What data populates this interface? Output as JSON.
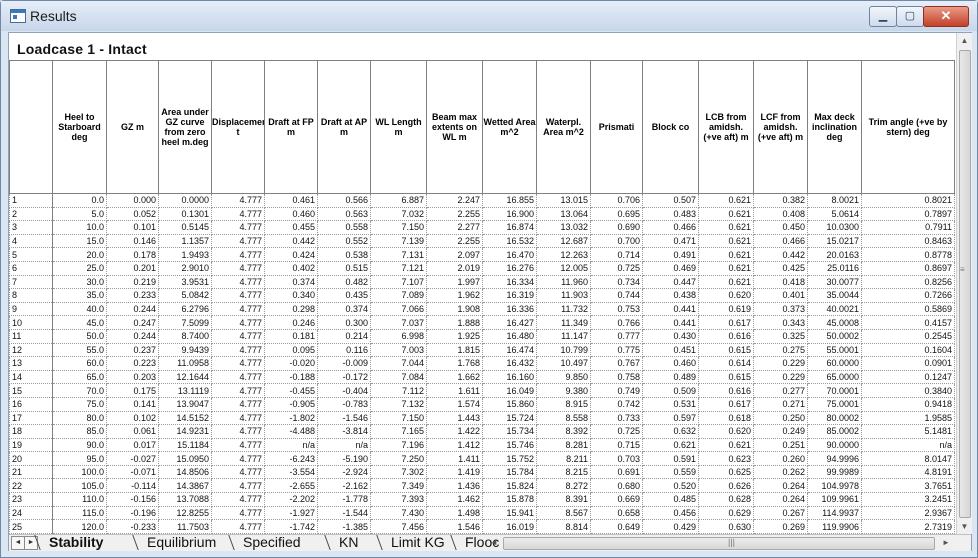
{
  "window": {
    "title": "Results",
    "minimize": "▁",
    "maximize": "▢",
    "close": "✕"
  },
  "loadcase_title": "Loadcase 1 - Intact",
  "columns": [
    "Heel to Starboard deg",
    "GZ m",
    "Area under GZ curve from zero heel m.deg",
    "Displacement t",
    "Draft at FP m",
    "Draft at AP m",
    "WL Length m",
    "Beam max extents on WL m",
    "Wetted Area m^2",
    "Waterpl. Area m^2",
    "Prismati",
    "Block co",
    "LCB from amidsh. (+ve aft) m",
    "LCF from amidsh. (+ve aft) m",
    "Max deck inclination deg",
    "Trim angle (+ve by stern) deg"
  ],
  "rows": [
    [
      "1",
      "0.0",
      "0.000",
      "0.0000",
      "4.777",
      "0.461",
      "0.566",
      "6.887",
      "2.247",
      "16.855",
      "13.015",
      "0.706",
      "0.507",
      "0.621",
      "0.382",
      "8.0021",
      "0.8021"
    ],
    [
      "2",
      "5.0",
      "0.052",
      "0.1301",
      "4.777",
      "0.460",
      "0.563",
      "7.032",
      "2.255",
      "16.900",
      "13.064",
      "0.695",
      "0.483",
      "0.621",
      "0.408",
      "5.0614",
      "0.7897"
    ],
    [
      "3",
      "10.0",
      "0.101",
      "0.5145",
      "4.777",
      "0.455",
      "0.558",
      "7.150",
      "2.277",
      "16.874",
      "13.032",
      "0.690",
      "0.466",
      "0.621",
      "0.450",
      "10.0300",
      "0.7911"
    ],
    [
      "4",
      "15.0",
      "0.146",
      "1.1357",
      "4.777",
      "0.442",
      "0.552",
      "7.139",
      "2.255",
      "16.532",
      "12.687",
      "0.700",
      "0.471",
      "0.621",
      "0.466",
      "15.0217",
      "0.8463"
    ],
    [
      "5",
      "20.0",
      "0.178",
      "1.9493",
      "4.777",
      "0.424",
      "0.538",
      "7.131",
      "2.097",
      "16.470",
      "12.263",
      "0.714",
      "0.491",
      "0.621",
      "0.442",
      "20.0163",
      "0.8778"
    ],
    [
      "6",
      "25.0",
      "0.201",
      "2.9010",
      "4.777",
      "0.402",
      "0.515",
      "7.121",
      "2.019",
      "16.276",
      "12.005",
      "0.725",
      "0.469",
      "0.621",
      "0.425",
      "25.0116",
      "0.8697"
    ],
    [
      "7",
      "30.0",
      "0.219",
      "3.9531",
      "4.777",
      "0.374",
      "0.482",
      "7.107",
      "1.997",
      "16.334",
      "11.960",
      "0.734",
      "0.447",
      "0.621",
      "0.418",
      "30.0077",
      "0.8256"
    ],
    [
      "8",
      "35.0",
      "0.233",
      "5.0842",
      "4.777",
      "0.340",
      "0.435",
      "7.089",
      "1.962",
      "16.319",
      "11.903",
      "0.744",
      "0.438",
      "0.620",
      "0.401",
      "35.0044",
      "0.7266"
    ],
    [
      "9",
      "40.0",
      "0.244",
      "6.2796",
      "4.777",
      "0.298",
      "0.374",
      "7.066",
      "1.908",
      "16.336",
      "11.732",
      "0.753",
      "0.441",
      "0.619",
      "0.373",
      "40.0021",
      "0.5869"
    ],
    [
      "10",
      "45.0",
      "0.247",
      "7.5099",
      "4.777",
      "0.246",
      "0.300",
      "7.037",
      "1.888",
      "16.427",
      "11.349",
      "0.766",
      "0.441",
      "0.617",
      "0.343",
      "45.0008",
      "0.4157"
    ],
    [
      "11",
      "50.0",
      "0.244",
      "8.7400",
      "4.777",
      "0.181",
      "0.214",
      "6.998",
      "1.925",
      "16.480",
      "11.147",
      "0.777",
      "0.430",
      "0.616",
      "0.325",
      "50.0002",
      "0.2545"
    ],
    [
      "12",
      "55.0",
      "0.237",
      "9.9439",
      "4.777",
      "0.095",
      "0.116",
      "7.003",
      "1.815",
      "16.474",
      "10.799",
      "0.775",
      "0.451",
      "0.615",
      "0.275",
      "55.0001",
      "0.1604"
    ],
    [
      "13",
      "60.0",
      "0.223",
      "11.0958",
      "4.777",
      "-0.020",
      "-0.009",
      "7.044",
      "1.768",
      "16.432",
      "10.497",
      "0.767",
      "0.460",
      "0.614",
      "0.229",
      "60.0000",
      "0.0901"
    ],
    [
      "14",
      "65.0",
      "0.203",
      "12.1644",
      "4.777",
      "-0.188",
      "-0.172",
      "7.084",
      "1.662",
      "16.160",
      "9.850",
      "0.758",
      "0.489",
      "0.615",
      "0.229",
      "65.0000",
      "0.1247"
    ],
    [
      "15",
      "70.0",
      "0.175",
      "13.1119",
      "4.777",
      "-0.455",
      "-0.404",
      "7.112",
      "1.611",
      "16.049",
      "9.380",
      "0.749",
      "0.509",
      "0.616",
      "0.277",
      "70.0001",
      "0.3840"
    ],
    [
      "16",
      "75.0",
      "0.141",
      "13.9047",
      "4.777",
      "-0.905",
      "-0.783",
      "7.132",
      "1.574",
      "15.860",
      "8.915",
      "0.742",
      "0.531",
      "0.617",
      "0.271",
      "75.0001",
      "0.9418"
    ],
    [
      "17",
      "80.0",
      "0.102",
      "14.5152",
      "4.777",
      "-1.802",
      "-1.546",
      "7.150",
      "1.443",
      "15.724",
      "8.558",
      "0.733",
      "0.597",
      "0.618",
      "0.250",
      "80.0002",
      "1.9585"
    ],
    [
      "18",
      "85.0",
      "0.061",
      "14.9231",
      "4.777",
      "-4.488",
      "-3.814",
      "7.165",
      "1.422",
      "15.734",
      "8.392",
      "0.725",
      "0.632",
      "0.620",
      "0.249",
      "85.0002",
      "5.1481"
    ],
    [
      "19",
      "90.0",
      "0.017",
      "15.1184",
      "4.777",
      "n/a",
      "n/a",
      "7.196",
      "1.412",
      "15.746",
      "8.281",
      "0.715",
      "0.621",
      "0.621",
      "0.251",
      "90.0000",
      "n/a"
    ],
    [
      "20",
      "95.0",
      "-0.027",
      "15.0950",
      "4.777",
      "-6.243",
      "-5.190",
      "7.250",
      "1.411",
      "15.752",
      "8.211",
      "0.703",
      "0.591",
      "0.623",
      "0.260",
      "94.9996",
      "8.0147"
    ],
    [
      "21",
      "100.0",
      "-0.071",
      "14.8506",
      "4.777",
      "-3.554",
      "-2.924",
      "7.302",
      "1.419",
      "15.784",
      "8.215",
      "0.691",
      "0.559",
      "0.625",
      "0.262",
      "99.9989",
      "4.8191"
    ],
    [
      "22",
      "105.0",
      "-0.114",
      "14.3867",
      "4.777",
      "-2.655",
      "-2.162",
      "7.349",
      "1.436",
      "15.824",
      "8.272",
      "0.680",
      "0.520",
      "0.626",
      "0.264",
      "104.9978",
      "3.7651"
    ],
    [
      "23",
      "110.0",
      "-0.156",
      "13.7088",
      "4.777",
      "-2.202",
      "-1.778",
      "7.393",
      "1.462",
      "15.878",
      "8.391",
      "0.669",
      "0.485",
      "0.628",
      "0.264",
      "109.9961",
      "3.2451"
    ],
    [
      "24",
      "115.0",
      "-0.196",
      "12.8255",
      "4.777",
      "-1.927",
      "-1.544",
      "7.430",
      "1.498",
      "15.941",
      "8.567",
      "0.658",
      "0.456",
      "0.629",
      "0.267",
      "114.9937",
      "2.9367"
    ],
    [
      "25",
      "120.0",
      "-0.233",
      "11.7503",
      "4.777",
      "-1.742",
      "-1.385",
      "7.456",
      "1.546",
      "16.019",
      "8.814",
      "0.649",
      "0.429",
      "0.630",
      "0.269",
      "119.9906",
      "2.7319"
    ]
  ],
  "tabs": [
    "Stability",
    "Equilibrium",
    "Specified",
    "KN",
    "Limit KG",
    "Flooc"
  ],
  "active_tab": "Stability",
  "scroll": {
    "up": "▲",
    "down": "▼",
    "left": "◄",
    "right": "►",
    "grip": "≡",
    "hgrip": "|||"
  },
  "nav": {
    "prev": "◄",
    "next": "►"
  }
}
